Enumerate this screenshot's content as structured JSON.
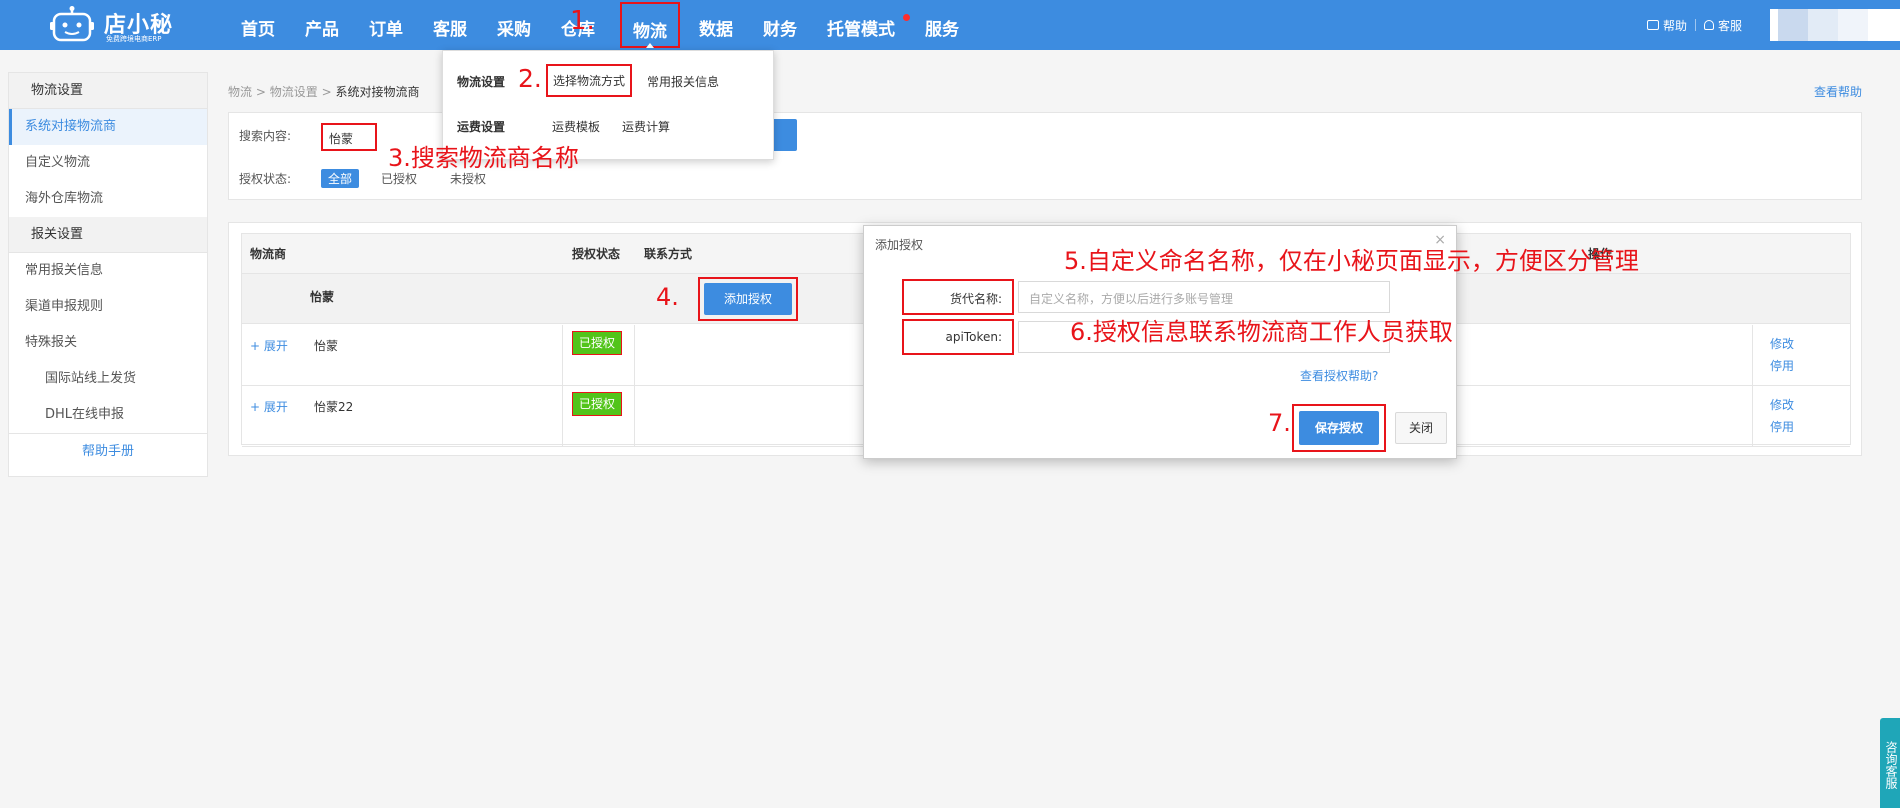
{
  "logo": {
    "name": "店小秘",
    "sub": "免费跨境电商ERP"
  },
  "nav": {
    "items": [
      {
        "label": "首页"
      },
      {
        "label": "产品"
      },
      {
        "label": "订单"
      },
      {
        "label": "客服"
      },
      {
        "label": "采购"
      },
      {
        "label": "仓库"
      },
      {
        "label": "物流"
      },
      {
        "label": "数据"
      },
      {
        "label": "财务"
      },
      {
        "label": "托管模式"
      },
      {
        "label": "服务"
      }
    ],
    "active_index": 6,
    "step_num": "1."
  },
  "top_right": {
    "help": "帮助",
    "service": "客服"
  },
  "sidebar": {
    "groups": [
      {
        "title": "物流设置",
        "items": [
          "系统对接物流商",
          "自定义物流",
          "海外仓库物流"
        ]
      },
      {
        "title": "报关设置",
        "items": [
          "常用报关信息",
          "渠道申报规则",
          "特殊报关",
          "国际站线上发货",
          "DHL在线申报"
        ]
      }
    ],
    "help": "帮助手册"
  },
  "breadcrumb": {
    "l1": "物流",
    "sep": ">",
    "l2": "物流设置",
    "l3": "系统对接物流商"
  },
  "help_link": "查看帮助",
  "search": {
    "label": "搜索内容:",
    "value": "怡蒙",
    "status_label": "授权状态:",
    "filters": [
      "全部",
      "已授权",
      "未授权"
    ]
  },
  "dropdown": {
    "row1_title": "物流设置",
    "row1_links": [
      "选择物流方式",
      "常用报关信息"
    ],
    "row2_title": "运费设置",
    "row2_links": [
      "运费模板",
      "运费计算"
    ]
  },
  "table": {
    "headers": {
      "carrier": "物流商",
      "status": "授权状态",
      "contact": "联系方式",
      "action": "操作"
    },
    "group_name": "怡蒙",
    "add_auth": "添加授权",
    "rows": [
      {
        "expand": "+ 展开",
        "name": "怡蒙",
        "status": "已授权",
        "op1": "修改",
        "op2": "停用"
      },
      {
        "expand": "+ 展开",
        "name": "怡蒙22",
        "status": "已授权",
        "op1": "修改",
        "op2": "停用"
      }
    ]
  },
  "dialog": {
    "title": "添加授权",
    "close": "×",
    "field1_label": "货代名称:",
    "field1_placeholder": "自定义名称，方便以后进行多账号管理",
    "field2_label": "apiToken:",
    "help_link": "查看授权帮助?",
    "save": "保存授权",
    "close_btn": "关闭"
  },
  "annotations": {
    "a2": "2.",
    "a3": "3.搜索物流商名称",
    "a4": "4.",
    "a5": "5.自定义命名名称，仅在小秘页面显示，方便区分管理",
    "a6": "6.授权信息联系物流商工作人员获取",
    "a7": "7."
  },
  "float_service": "咨询客服",
  "colors": {
    "primary": "#3d8ce0",
    "annotation": "#e8141a",
    "success": "#52c41a"
  }
}
